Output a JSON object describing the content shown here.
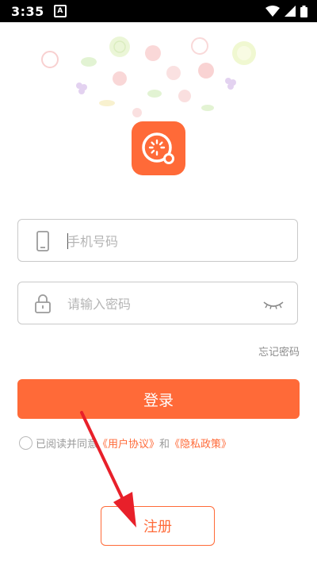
{
  "status_bar": {
    "time": "3:35",
    "notification_badge": "A"
  },
  "login": {
    "phone_placeholder": "手机号码",
    "password_placeholder": "请输入密码",
    "forgot_password": "忘记密码",
    "login_button": "登录"
  },
  "agreement": {
    "prefix": "已阅读并同意",
    "user_agreement": "《用户协议》",
    "and": "和",
    "privacy_policy": "《隐私政策》"
  },
  "register_button": "注册",
  "colors": {
    "accent": "#ff6a38",
    "annotation_arrow": "#e8202a"
  }
}
